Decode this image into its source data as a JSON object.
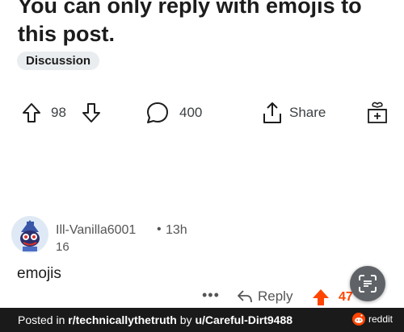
{
  "post": {
    "title": "You can only reply with emojis to this post.",
    "flair": "Discussion",
    "vote_count": "98",
    "comment_count": "400",
    "share_label": "Share"
  },
  "comment": {
    "author": "Ill-Vanilla6001",
    "separator": "•",
    "time": "13h",
    "flair": "16",
    "body": "emojis",
    "more": "•••",
    "reply_label": "Reply",
    "score": "47"
  },
  "footer": {
    "prefix": "Posted in ",
    "subreddit": "r/technicallythetruth",
    "by": " by ",
    "user": "u/Careful-Dirt9488",
    "brand": "reddit"
  },
  "colors": {
    "upvote_accent": "#ff4500",
    "footer_bg": "#1a1a1b",
    "flair_bg": "#eaedef"
  },
  "icons": [
    "upvote-icon",
    "downvote-icon",
    "comment-icon",
    "share-icon",
    "award-icon",
    "reply-icon",
    "google-lens-icon",
    "reddit-logo-icon"
  ]
}
